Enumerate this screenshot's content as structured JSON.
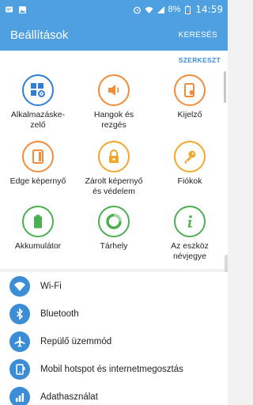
{
  "status_bar": {
    "battery_percent": "8%",
    "time": "14:59",
    "icons": [
      "message-icon",
      "image-icon",
      "alarm-icon",
      "wifi-icon",
      "signal-icon",
      "battery-icon"
    ]
  },
  "app_bar": {
    "title": "Beállítások",
    "action": "KERESÉS"
  },
  "quick_settings": {
    "edit_label": "SZERKESZT",
    "tiles": [
      {
        "label": "Alkalmazáske-\nzelő",
        "icon": "app-manager-icon",
        "color": "#2f7fd4"
      },
      {
        "label": "Hangok és\nrezgés",
        "icon": "speaker-icon",
        "color": "#f08c3a"
      },
      {
        "label": "Kijelző",
        "icon": "display-icon",
        "color": "#f08c3a"
      },
      {
        "label": "Edge képernyő",
        "icon": "edge-screen-icon",
        "color": "#f08c3a"
      },
      {
        "label": "Zárolt képernyő\nés védelem",
        "icon": "lock-icon",
        "color": "#f0a82a"
      },
      {
        "label": "Fiókok",
        "icon": "key-icon",
        "color": "#f0a82a"
      },
      {
        "label": "Akkumulátor",
        "icon": "battery-icon",
        "color": "#4caf50"
      },
      {
        "label": "Tárhely",
        "icon": "storage-icon",
        "color": "#4caf50"
      },
      {
        "label": "Az eszköz\nnévjegye",
        "icon": "info-icon",
        "color": "#4caf50"
      }
    ]
  },
  "list": {
    "items": [
      {
        "label": "Wi-Fi",
        "icon": "wifi-icon"
      },
      {
        "label": "Bluetooth",
        "icon": "bluetooth-icon"
      },
      {
        "label": "Repülő üzemmód",
        "icon": "airplane-icon"
      },
      {
        "label": "Mobil hotspot és internetmegosztás",
        "icon": "hotspot-icon"
      },
      {
        "label": "Adathasználat",
        "icon": "data-usage-icon"
      }
    ]
  },
  "colors": {
    "accent": "#4fa0e0",
    "list_icon": "#3b8ed6"
  }
}
